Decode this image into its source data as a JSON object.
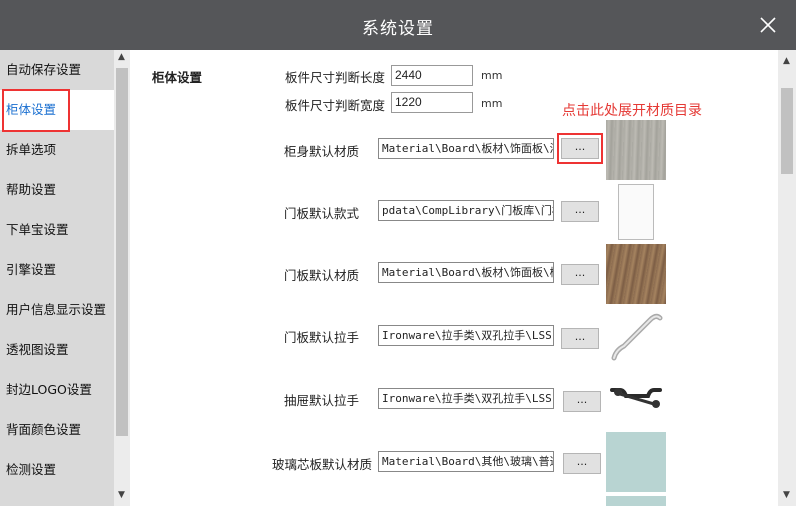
{
  "window": {
    "title": "系统设置"
  },
  "sidebar": {
    "items": [
      {
        "label": "自动保存设置"
      },
      {
        "label": "柜体设置"
      },
      {
        "label": "拆单选项"
      },
      {
        "label": "帮助设置"
      },
      {
        "label": "下单宝设置"
      },
      {
        "label": "引擎设置"
      },
      {
        "label": "用户信息显示设置"
      },
      {
        "label": "透视图设置"
      },
      {
        "label": "封边LOGO设置"
      },
      {
        "label": "背面颜色设置"
      },
      {
        "label": "检测设置"
      }
    ]
  },
  "main": {
    "section_title": "柜体设置",
    "length_label": "板件尺寸判断长度",
    "length_value": "2440",
    "width_label": "板件尺寸判断宽度",
    "width_value": "1220",
    "unit": "mm",
    "annotation": "点击此处展开材质目录",
    "browse_label": "...",
    "rows": [
      {
        "label": "柜身默认材质",
        "path": "Material\\Board\\板材\\饰面板\\浅灰木纹"
      },
      {
        "label": "门板默认款式",
        "path": "pdata\\CompLibrary\\门板库\\门板"
      },
      {
        "label": "门板默认材质",
        "path": "Material\\Board\\板材\\饰面板\\橡木"
      },
      {
        "label": "门板默认拉手",
        "path": "Ironware\\拉手类\\双孔拉手\\LSS"
      },
      {
        "label": "抽屉默认拉手",
        "path": "Ironware\\拉手类\\双孔拉手\\LSS"
      },
      {
        "label": "玻璃芯板默认材质",
        "path": "Material\\Board\\其他\\玻璃\\普通"
      }
    ]
  },
  "colors": {
    "titlebar": "#555659",
    "sidebar": "#d9d9d9",
    "highlight": "#e53935",
    "active_text": "#1a6fd0"
  },
  "icons": {
    "close": "close-icon"
  }
}
